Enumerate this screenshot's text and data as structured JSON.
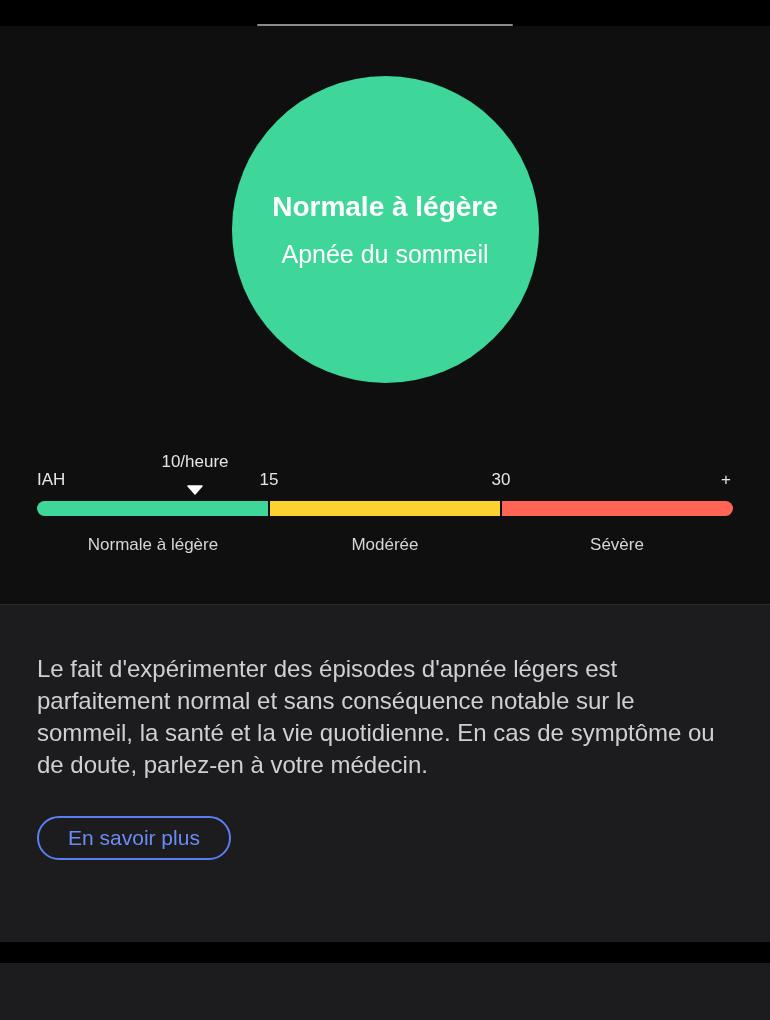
{
  "result": {
    "title": "Normale à légère",
    "subtitle": "Apnée du sommeil",
    "color": "#3fd699"
  },
  "scale": {
    "axis_label": "IAH",
    "end_label": "+",
    "marker": {
      "label": "10/heure",
      "level": 0.227
    },
    "ticks": [
      "15",
      "30"
    ],
    "segments": [
      {
        "label": "Normale à légère",
        "color": "#3fd699"
      },
      {
        "label": "Modérée",
        "color": "#fbd22e"
      },
      {
        "label": "Sévère",
        "color": "#fe6554"
      }
    ]
  },
  "description": "Le fait d'expérimenter des épisodes d'apnée légers est parfaitement normal et sans conséquence notable sur le sommeil, la santé et la vie quotidienne. En cas de symptôme ou de doute, parlez-en à votre médecin.",
  "link_button": "En savoir plus"
}
